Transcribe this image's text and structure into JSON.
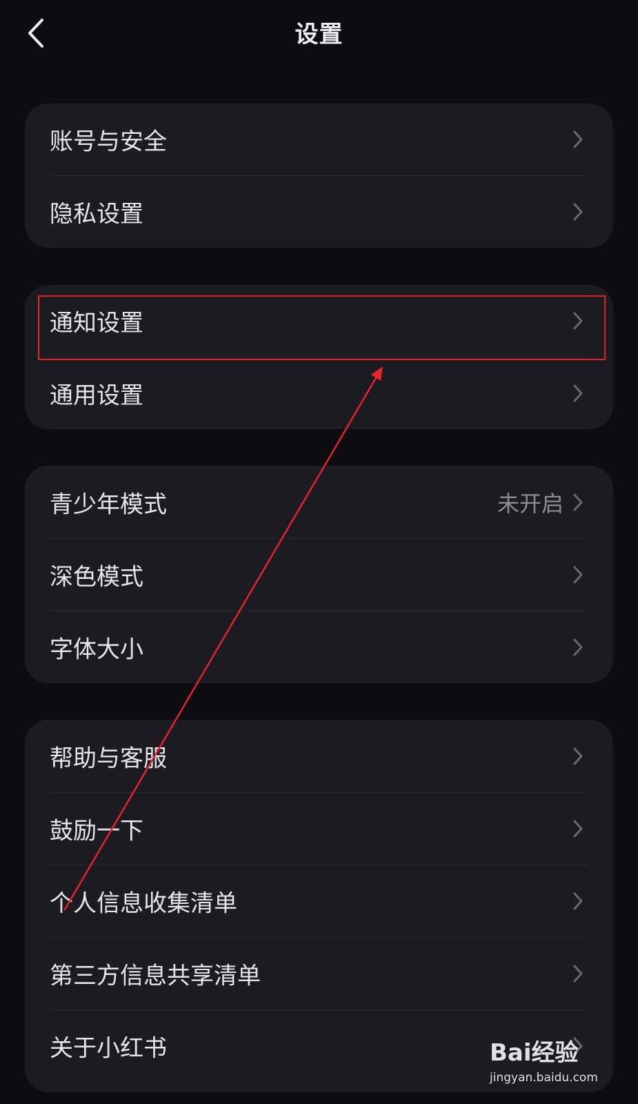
{
  "header": {
    "title": "设置",
    "back_icon": "chevron-left-icon"
  },
  "groups": [
    {
      "items": [
        {
          "label": "账号与安全",
          "value": ""
        },
        {
          "label": "隐私设置",
          "value": ""
        }
      ]
    },
    {
      "items": [
        {
          "label": "通知设置",
          "value": ""
        },
        {
          "label": "通用设置",
          "value": ""
        }
      ]
    },
    {
      "items": [
        {
          "label": "青少年模式",
          "value": "未开启"
        },
        {
          "label": "深色模式",
          "value": ""
        },
        {
          "label": "字体大小",
          "value": ""
        }
      ]
    },
    {
      "items": [
        {
          "label": "帮助与客服",
          "value": ""
        },
        {
          "label": "鼓励一下",
          "value": ""
        },
        {
          "label": "个人信息收集清单",
          "value": ""
        },
        {
          "label": "第三方信息共享清单",
          "value": ""
        },
        {
          "label": "关于小红书",
          "value": ""
        }
      ]
    }
  ],
  "annotation": {
    "color": "#e5232a",
    "highlighted_item": "通知设置"
  },
  "watermark": {
    "brand": "Bai经验",
    "url": "jingyan.baidu.com"
  },
  "colors": {
    "background": "#0d0c11",
    "card": "#1c1b21",
    "text": "#e6e6e9",
    "secondary_text": "#8d8c93",
    "chevron": "#6a6970",
    "annotation": "#e5232a"
  }
}
